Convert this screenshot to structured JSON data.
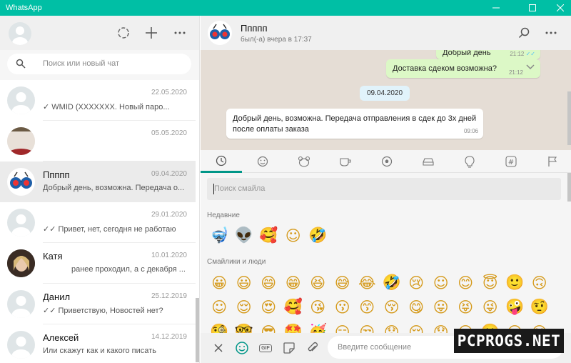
{
  "window": {
    "title": "WhatsApp",
    "accent": "#00bfa5"
  },
  "left": {
    "search_placeholder": "Поиск или новый чат",
    "chats": [
      {
        "name": "",
        "date": "22.05.2020",
        "message": "✓ WMID          (XXXXXXX. Новый паро...",
        "avatar": "default"
      },
      {
        "name": "",
        "date": "05.05.2020",
        "message": "",
        "avatar": "photo-red"
      },
      {
        "name": "Ппппп",
        "date": "09.04.2020",
        "message": "Добрый день, возможна. Передача о...",
        "avatar": "glasses",
        "active": true
      },
      {
        "name": "",
        "date": "29.01.2020",
        "message": "✓✓ Привет, нет, сегодня не работаю",
        "avatar": "default"
      },
      {
        "name": "Катя",
        "date": "10.01.2020",
        "message": "ранее проходил, а с декабря ...",
        "avatar": "photo-girl"
      },
      {
        "name": "Данил",
        "date": "25.12.2019",
        "message": "✓✓ Приветствую, Новостей нет?",
        "avatar": "default"
      },
      {
        "name": "Алексей",
        "date": "14.12.2019",
        "message": "Или скажут как и какого писать",
        "avatar": "default"
      }
    ]
  },
  "conversation": {
    "name": "Ппппп",
    "status": "был(-а) вчера в 17:37",
    "messages": {
      "out1_text": "Добрый день",
      "out1_time": "21:12",
      "out2_text": "Доставка сдеком возможна?",
      "out2_time": "21:12",
      "date_chip": "09.04.2020",
      "in1_text": "Добрый день, возможна. Передача отправления в сдек до 3х дней после оплаты заказа",
      "in1_time": "09:06"
    }
  },
  "emoji_panel": {
    "search_placeholder": "Поиск смайла",
    "recent_label": "Недавние",
    "recent": [
      "🤿",
      "👽",
      "🥰",
      "☺",
      "🤣"
    ],
    "people_label": "Смайлики и люди",
    "people_row1": [
      "😀",
      "😃",
      "😄",
      "😁",
      "😆",
      "😅",
      "😂",
      "🤣",
      "😢",
      "☺",
      "😊",
      "😇",
      "🙂",
      "🙃"
    ],
    "people_row2": [
      "☺",
      "😌",
      "😍",
      "🥰",
      "😘",
      "😗",
      "😙",
      "😚",
      "😋",
      "😛",
      "😝",
      "😜",
      "🤪",
      "🤨"
    ],
    "people_row3": [
      "🧐",
      "🤓",
      "😎",
      "🤩",
      "🥳",
      "😏",
      "😒",
      "😞",
      "😔",
      "😟",
      "😕",
      "🙁",
      "☹",
      "😣"
    ],
    "tabs": [
      "recent-icon",
      "smiley-icon",
      "animal-icon",
      "food-icon",
      "sport-icon",
      "car-icon",
      "bulb-icon",
      "symbols-icon",
      "flag-icon"
    ]
  },
  "footer": {
    "input_placeholder": "Введите сообщение",
    "gif_label": "GIF"
  },
  "watermark": {
    "text": "PCPROGS.NET"
  }
}
